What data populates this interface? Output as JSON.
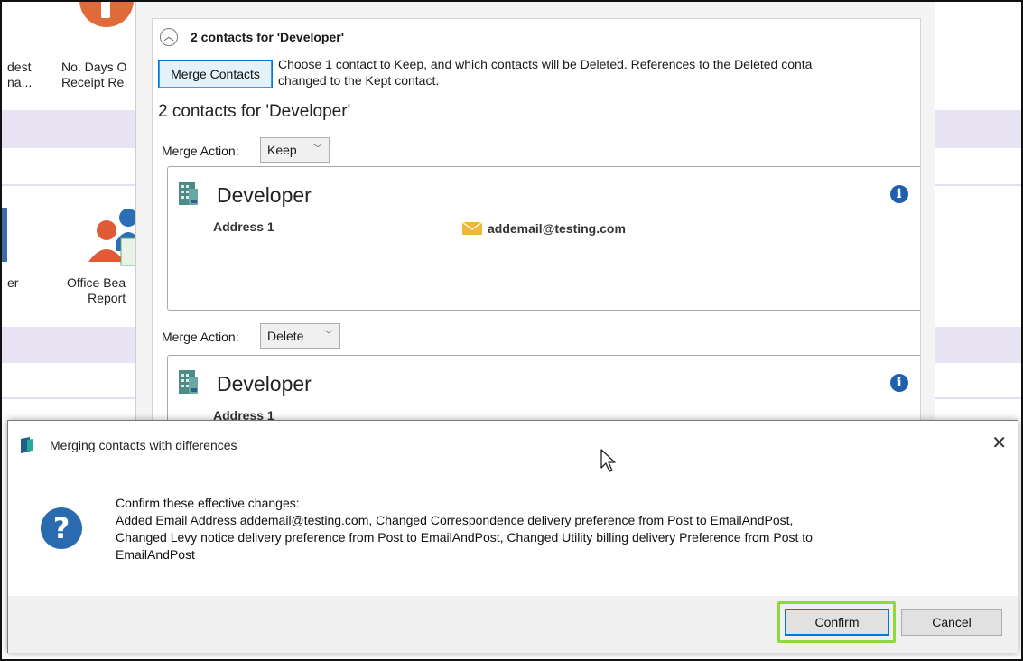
{
  "background_tiles": {
    "tile1_line1": "dest",
    "tile1_line2": "na...",
    "tile2_line1": "No. Days O",
    "tile2_line2": "Receipt Re",
    "tile3_label": "er",
    "tile4_line1": "Office Bea",
    "tile4_line2": "Report"
  },
  "group": {
    "title": "2 contacts for 'Developer'",
    "merge_button_label": "Merge Contacts",
    "merge_desc_line1": "Choose 1 contact to Keep, and which contacts will be Deleted. References to the Deleted conta",
    "merge_desc_line2": "changed to the Kept contact.",
    "subtitle": "2 contacts for 'Developer'"
  },
  "contacts": [
    {
      "merge_action_label": "Merge Action:",
      "merge_action_value": "Keep",
      "name": "Developer",
      "address": "Address 1",
      "email": "addemail@testing.com"
    },
    {
      "merge_action_label": "Merge Action:",
      "merge_action_value": "Delete",
      "name": "Developer",
      "address": "Address 1"
    }
  ],
  "dialog": {
    "title": "Merging contacts with differences",
    "close_glyph": "✕",
    "message_heading": "Confirm these effective changes:",
    "message_line1": "Added Email Address addemail@testing.com, Changed Correspondence delivery preference from Post to EmailAndPost,",
    "message_line2": "Changed Levy notice delivery preference from Post to EmailAndPost, Changed Utility billing delivery Preference from Post to",
    "message_line3": "EmailAndPost",
    "confirm_label": "Confirm",
    "cancel_label": "Cancel",
    "question_glyph": "?"
  },
  "colors": {
    "accent_blue": "#0078d7",
    "highlight_green": "#8fd93a",
    "band_lilac": "#e9e4f3",
    "info_blue": "#1e5fae",
    "email_icon": "#f0b73e"
  },
  "icons": [
    "collapse-up-icon",
    "building-icon",
    "envelope-icon",
    "info-icon",
    "question-icon",
    "close-icon",
    "app-icon",
    "mouse-cursor-icon"
  ]
}
